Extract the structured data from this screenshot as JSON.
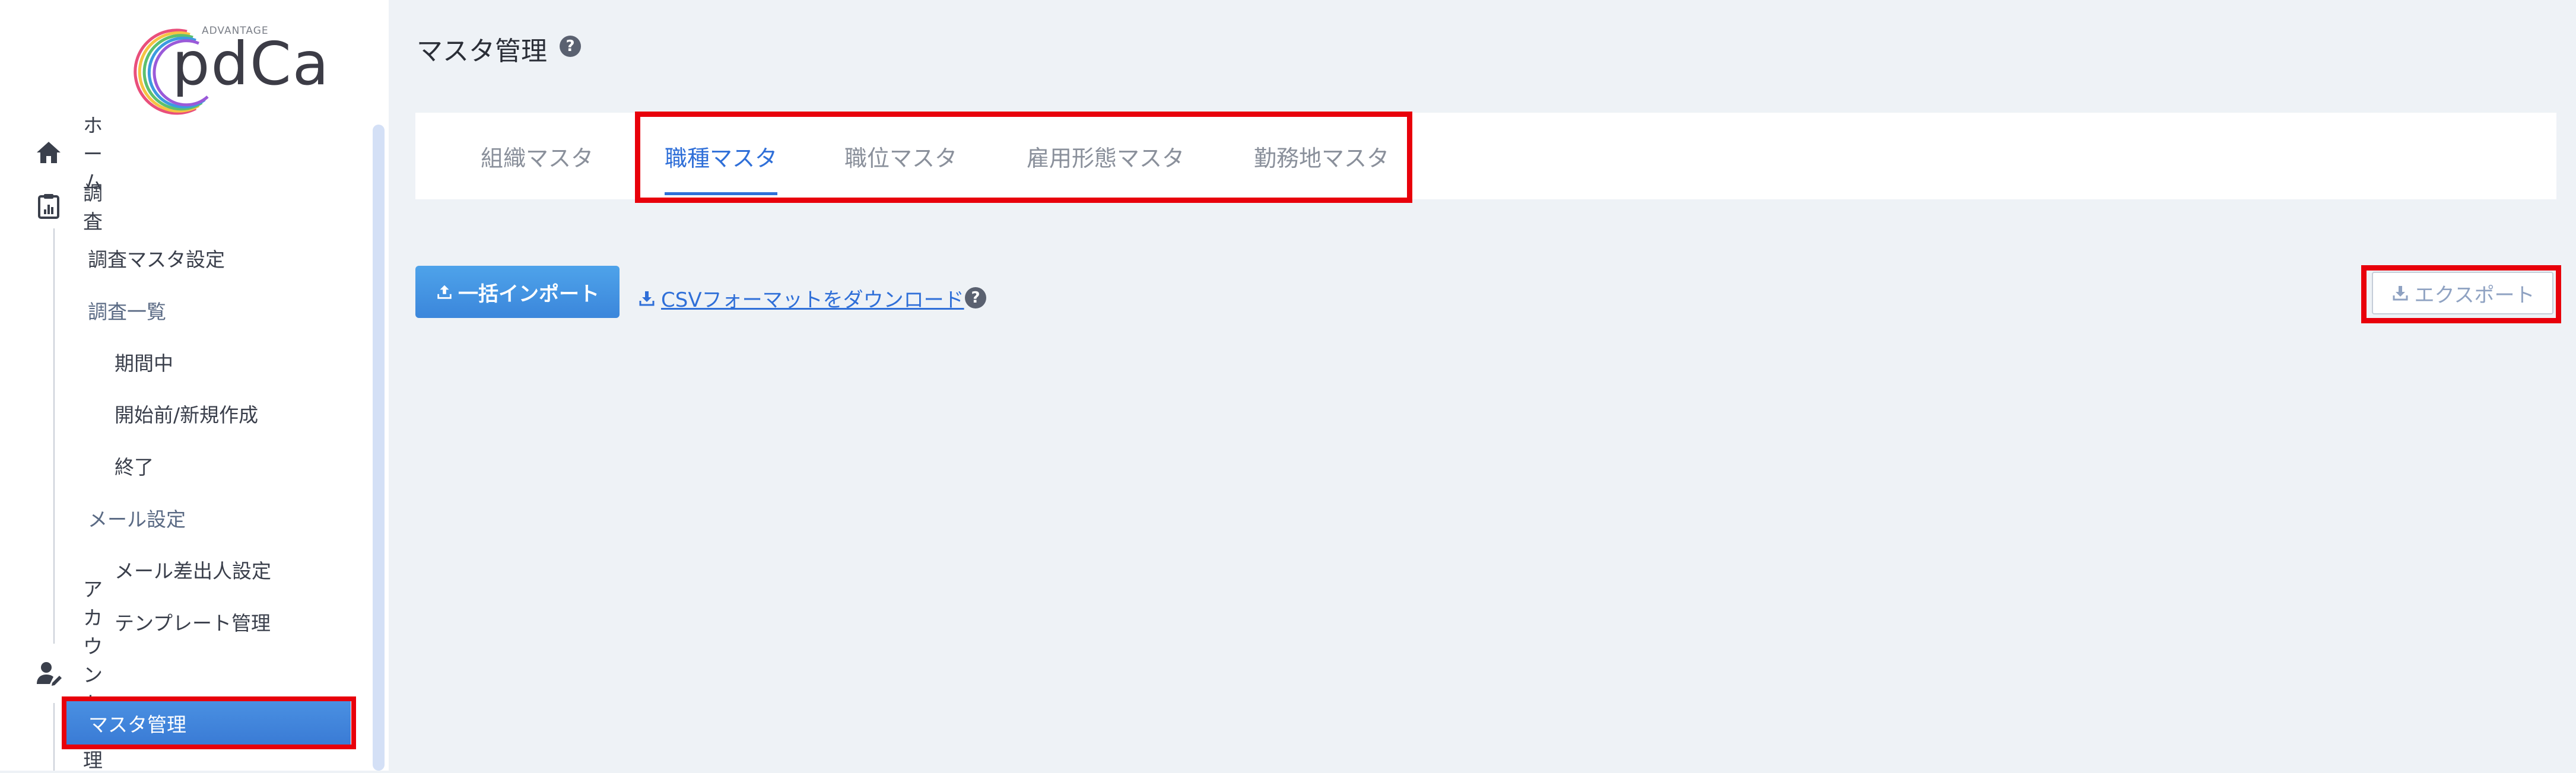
{
  "sidebar": {
    "logo": {
      "small_text": "ADVANTAGE",
      "word": "pdCa"
    },
    "items": [
      {
        "label": "ホーム",
        "icon": "home-icon"
      },
      {
        "label": "調査",
        "icon": "clipboard-chart-icon"
      },
      {
        "label": "調査マスタ設定"
      },
      {
        "label": "調査一覧"
      },
      {
        "label": "期間中"
      },
      {
        "label": "開始前/新規作成"
      },
      {
        "label": "終了"
      },
      {
        "label": "メール設定"
      },
      {
        "label": "メール差出人設定"
      },
      {
        "label": "テンプレート管理"
      },
      {
        "label": "アカウント管理",
        "icon": "user-edit-icon"
      },
      {
        "label": "マスタ管理",
        "active": true
      }
    ]
  },
  "header": {
    "title": "マスタ管理"
  },
  "tabs": [
    {
      "label": "組織マスタ"
    },
    {
      "label": "職種マスタ",
      "active": true
    },
    {
      "label": "職位マスタ"
    },
    {
      "label": "雇用形態マスタ"
    },
    {
      "label": "勤務地マスタ"
    }
  ],
  "actions": {
    "import_label": "一括インポート",
    "csv_link_label": "CSVフォーマットをダウンロード",
    "export_label": "エクスポート"
  },
  "colors": {
    "accent": "#2f6fd8",
    "highlight": "#e8000b",
    "background": "#eef2f6"
  }
}
